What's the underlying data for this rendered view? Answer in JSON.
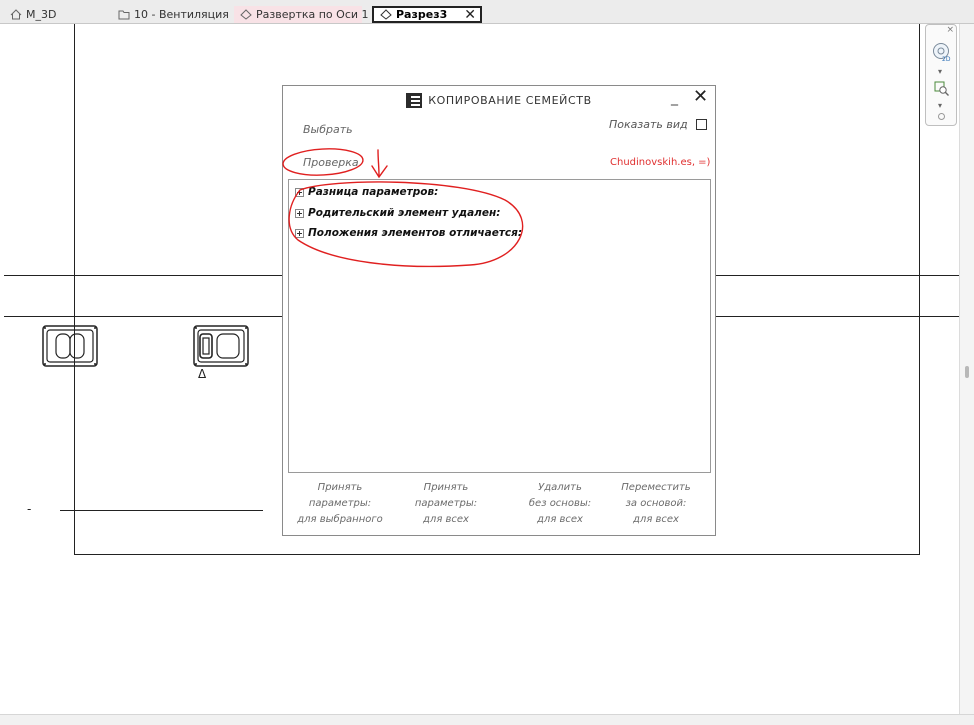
{
  "tabs": [
    {
      "label": "M_3D",
      "icon": "home-icon"
    },
    {
      "label": "10 - Вентиляция",
      "icon": "sheet-icon"
    },
    {
      "label": "Развертка по Оси 1",
      "icon": "elevation-icon"
    },
    {
      "label": "Разрез3",
      "icon": "section-icon",
      "active": true,
      "close": "✕"
    }
  ],
  "dialog": {
    "title": "КОПИРОВАНИЕ СЕМЕЙСТВ",
    "minimize": "_",
    "close": "✕",
    "select_label": "Выбрать",
    "check_label": "Проверка",
    "show_view_label": "Показать вид",
    "show_view_checked": false,
    "author": "Chudinovskih.es, =)",
    "tree": [
      {
        "label": "Разница параметров:"
      },
      {
        "label": "Родительский элемент удален:"
      },
      {
        "label": "Положения элементов отличается:"
      }
    ],
    "actions": [
      {
        "label": "Принять\nпараметры:\nдля выбранного"
      },
      {
        "label": "Принять\nпараметры:\nдля всех"
      },
      {
        "label": "Удалить\nбез основы:\nдля всех"
      },
      {
        "label": "Переместить\nза основой:\nдля всех"
      }
    ]
  },
  "drawing": {
    "section_mark": "Δ",
    "dash": "-"
  },
  "navbar": {
    "close": "×",
    "wheel_icon": "steering-wheel-2d-icon",
    "zoom_icon": "zoom-region-icon"
  },
  "colors": {
    "annotation": "#e02020",
    "author": "#e03030",
    "active_tab_border": "#222222",
    "pink_tab": "#f8e2e6"
  }
}
